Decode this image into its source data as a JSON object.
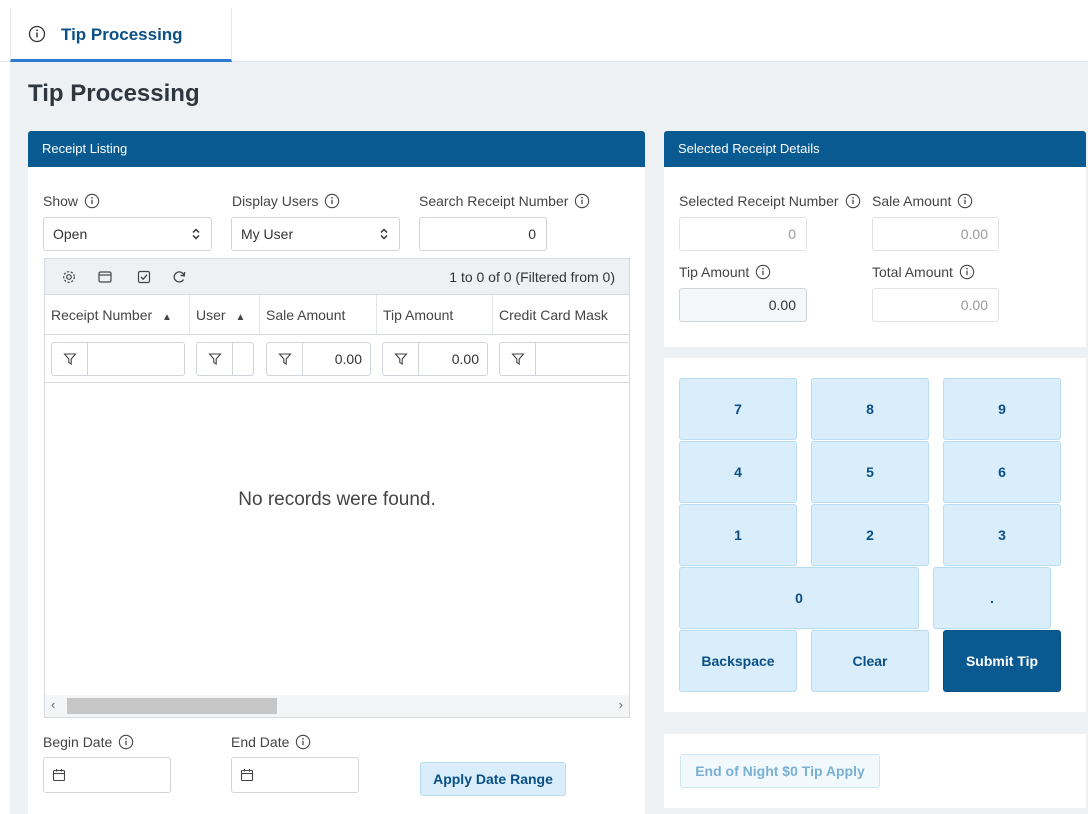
{
  "tab": {
    "label": "Tip Processing"
  },
  "page": {
    "title": "Tip Processing"
  },
  "receipt_listing": {
    "header": "Receipt Listing",
    "show": {
      "label": "Show",
      "value": "Open"
    },
    "display_users": {
      "label": "Display Users",
      "value": "My User"
    },
    "search": {
      "label": "Search Receipt Number",
      "value": "0"
    },
    "grid": {
      "count_text": "1 to 0 of 0 (Filtered from 0)",
      "columns": [
        {
          "label": "Receipt Number",
          "sort": "▲"
        },
        {
          "label": "User",
          "sort": "▲"
        },
        {
          "label": "Sale Amount",
          "sort": ""
        },
        {
          "label": "Tip Amount",
          "sort": ""
        },
        {
          "label": "Credit Card Mask",
          "sort": ""
        }
      ],
      "filters": {
        "sale_amount": "0.00",
        "tip_amount": "0.00"
      },
      "empty_text": "No records were found."
    },
    "begin_date": {
      "label": "Begin Date"
    },
    "end_date": {
      "label": "End Date"
    },
    "apply_label": "Apply Date Range"
  },
  "selected_receipt": {
    "header": "Selected Receipt Details",
    "receipt_number": {
      "label": "Selected Receipt Number",
      "value": "0"
    },
    "sale_amount": {
      "label": "Sale Amount",
      "value": "0.00"
    },
    "tip_amount": {
      "label": "Tip Amount",
      "value": "0.00"
    },
    "total_amount": {
      "label": "Total Amount",
      "value": "0.00"
    }
  },
  "keypad": {
    "k7": "7",
    "k8": "8",
    "k9": "9",
    "k4": "4",
    "k5": "5",
    "k6": "6",
    "k1": "1",
    "k2": "2",
    "k3": "3",
    "k0": "0",
    "kdot": ".",
    "backspace": "Backspace",
    "clear": "Clear",
    "submit": "Submit Tip"
  },
  "end_of_night_label": "End of Night $0 Tip Apply",
  "colors": {
    "primary": "#0a5a92",
    "accent_tab": "#2b7bd3",
    "key_bg": "#d9eefa"
  }
}
